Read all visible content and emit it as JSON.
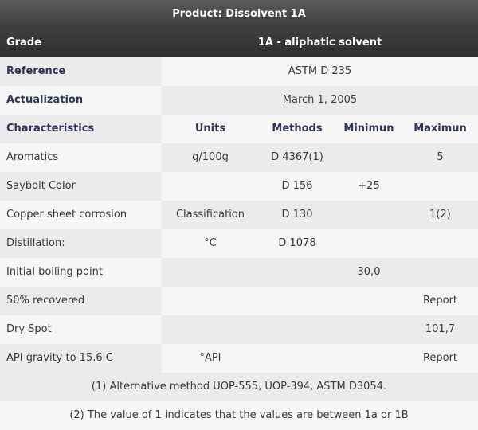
{
  "product_title": "Product: Dissolvent 1A",
  "grade": {
    "label": "Grade",
    "value": "1A - aliphatic solvent"
  },
  "reference": {
    "label": "Reference",
    "value": "ASTM D 235"
  },
  "actualization": {
    "label": "Actualization",
    "value": "March 1, 2005"
  },
  "columns": {
    "characteristics": "Characteristics",
    "units": "Units",
    "methods": "Methods",
    "minimum": "Minimun",
    "maximum": "Maximun"
  },
  "rows": [
    {
      "name": "Aromatics",
      "units": "g/100g",
      "method": "D 4367(1)",
      "min": "",
      "max": "5"
    },
    {
      "name": "Saybolt Color",
      "units": "",
      "method": "D 156",
      "min": "+25",
      "max": ""
    },
    {
      "name": "Copper sheet corrosion",
      "units": "Classification",
      "method": "D 130",
      "min": "",
      "max": "1(2)"
    },
    {
      "name": "Distillation:",
      "units": "°C",
      "method": "D 1078",
      "min": "",
      "max": ""
    },
    {
      "name": "Initial boiling point",
      "units": "",
      "method": "",
      "min": "30,0",
      "max": ""
    },
    {
      "name": "50% recovered",
      "units": "",
      "method": "",
      "min": "",
      "max": "Report"
    },
    {
      "name": "Dry Spot",
      "units": "",
      "method": "",
      "min": "",
      "max": "101,7"
    },
    {
      "name": "API gravity to 15.6 C",
      "units": "°API",
      "method": "",
      "min": "",
      "max": "Report"
    }
  ],
  "notes": [
    "(1) Alternative method UOP-555, UOP-394, ASTM D3054.",
    "(2) The value of 1 indicates that the values are between 1a or 1B"
  ]
}
